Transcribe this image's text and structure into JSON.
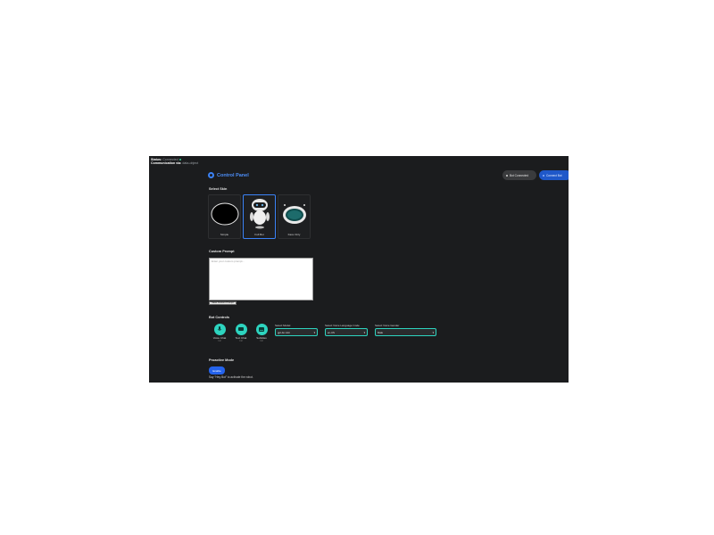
{
  "status": {
    "status_label": "Status:",
    "status_value": "Connected",
    "comm_label": "Communication via:",
    "comm_value": "data-object"
  },
  "header": {
    "title": "Control Panel",
    "bot_connected": "Bot Connected",
    "connect_bot": "Connect Bot"
  },
  "skins": {
    "section_title": "Select Skin",
    "items": [
      {
        "label": "Simple"
      },
      {
        "label": "Full Bot"
      },
      {
        "label": "Face Only"
      }
    ]
  },
  "prompt": {
    "section_title": "Custom Prompt",
    "placeholder": "Enter your custom prompt...",
    "save_label": "Save Custom Prompt"
  },
  "controls": {
    "section_title": "Bot Controls",
    "buttons": [
      {
        "label": "Voice Chat",
        "sub": "Ctrl"
      },
      {
        "label": "Text Chat",
        "sub": "Ctrl"
      },
      {
        "label": "Subtitles",
        "sub": "Ctrl"
      }
    ],
    "selects": [
      {
        "label": "Select Model",
        "value": "gpt-4o mini"
      },
      {
        "label": "Select Voice Language Code",
        "value": "en-US"
      },
      {
        "label": "Select Voice Gender",
        "value": "Male"
      }
    ]
  },
  "proactive": {
    "section_title": "Proactive Mode",
    "enable_label": "Enable",
    "hint": "Say \"Hey Bot\" to activate the robot."
  },
  "colors": {
    "background": "#1b1c1e",
    "accent_blue": "#3b82f6",
    "accent_teal": "#2dd4bf"
  }
}
